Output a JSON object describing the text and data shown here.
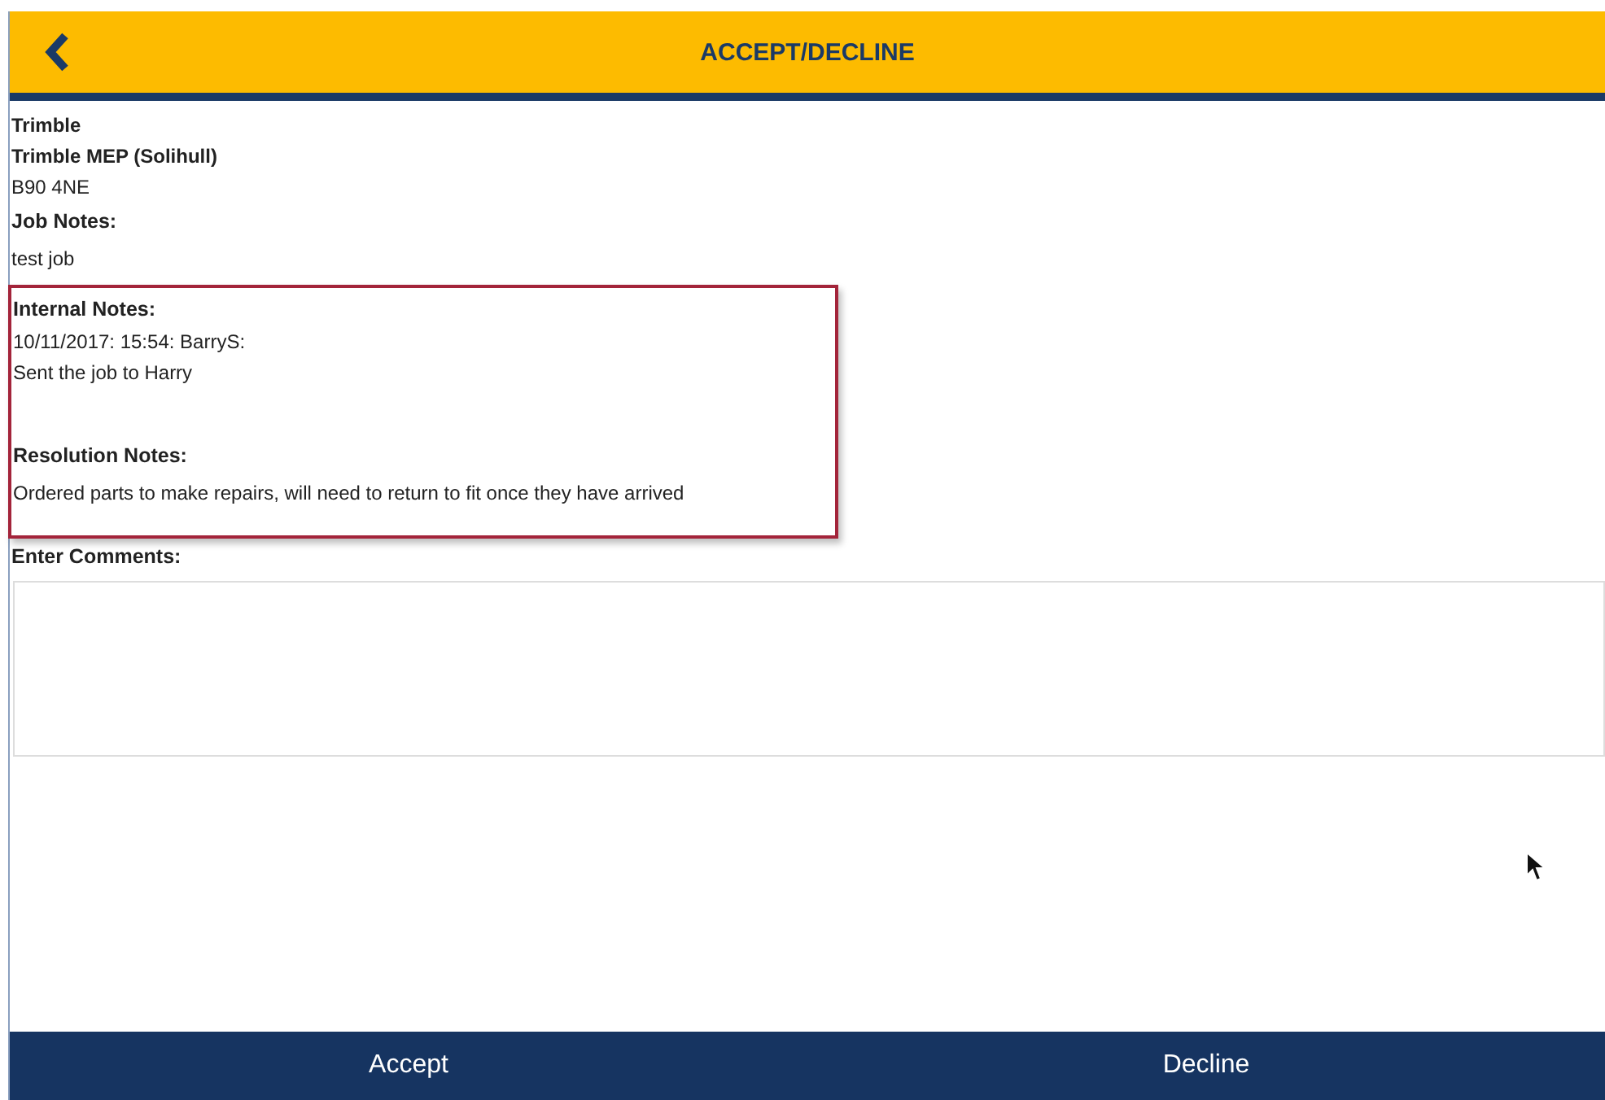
{
  "header": {
    "title": "ACCEPT/DECLINE"
  },
  "address": [
    {
      "text": "Trimble",
      "bold": true
    },
    {
      "text": "Trimble MEP (Solihull)",
      "bold": true
    },
    {
      "text": "B90 4NE",
      "bold": false
    }
  ],
  "job_notes": {
    "label": "Job Notes:",
    "text": "test job"
  },
  "highlighted": true,
  "internal_notes": {
    "label": "Internal Notes:",
    "lines": [
      "10/11/2017: 15:54: BarryS:",
      "Sent the job to Harry"
    ]
  },
  "resolution_notes": {
    "label": "Resolution Notes:",
    "text": "Ordered parts to make repairs, will need to return to fit once they have arrived"
  },
  "comments": {
    "label": "Enter Comments:"
  },
  "buttons": [
    "Accept",
    "Decline"
  ]
}
